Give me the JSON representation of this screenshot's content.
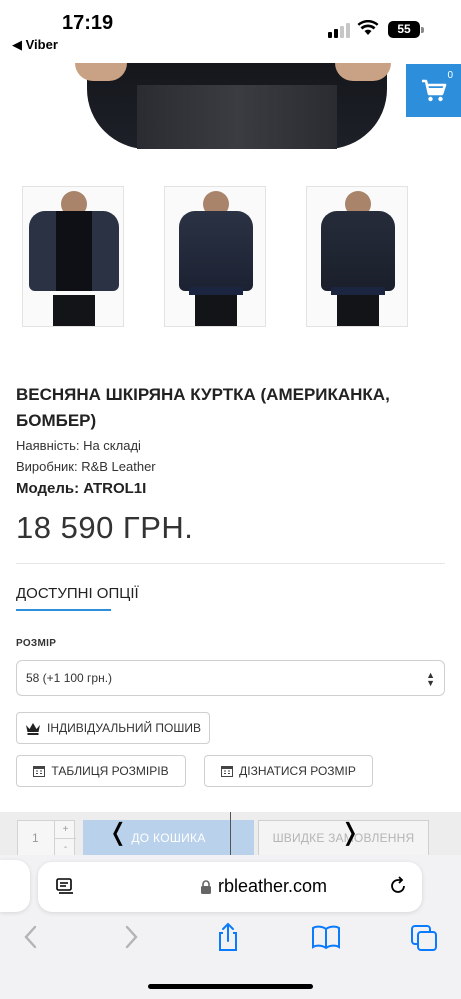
{
  "status_bar": {
    "time": "17:19",
    "back_app": "◀ Viber",
    "battery": "55"
  },
  "cart": {
    "count": "0"
  },
  "product": {
    "title": "ВЕСНЯНА ШКІРЯНА КУРТКА (АМЕРИКАНКА, БОМБЕР)",
    "availability": "Наявність: На складі",
    "manufacturer": "Виробник: R&B Leather",
    "model": "Модель: ATROL1I",
    "price": "18 590 ГРН."
  },
  "options": {
    "title": "ДОСТУПНІ ОПЦІЇ",
    "size_label": "РОЗМІР",
    "size_selected": "58 (+1 100 грн.)",
    "custom_tailoring_label": "ІНДИВІДУАЛЬНИЙ ПОШИВ",
    "size_table_label": "ТАБЛИЦЯ РОЗМІРІВ",
    "find_size_label": "ДІЗНАТИСЯ РОЗМІР"
  },
  "purchase": {
    "quantity": "1",
    "plus": "+",
    "minus": "-",
    "add_to_cart": "ДО КОШИКА",
    "quick_order": "ШВИДКЕ ЗАМОВЛЕННЯ"
  },
  "browser": {
    "url": "rbleather.com"
  },
  "colors": {
    "accent": "#2d8fdc",
    "add_to_cart_disabled": "#b9d1ea",
    "ios_blue": "#0a7aff"
  }
}
